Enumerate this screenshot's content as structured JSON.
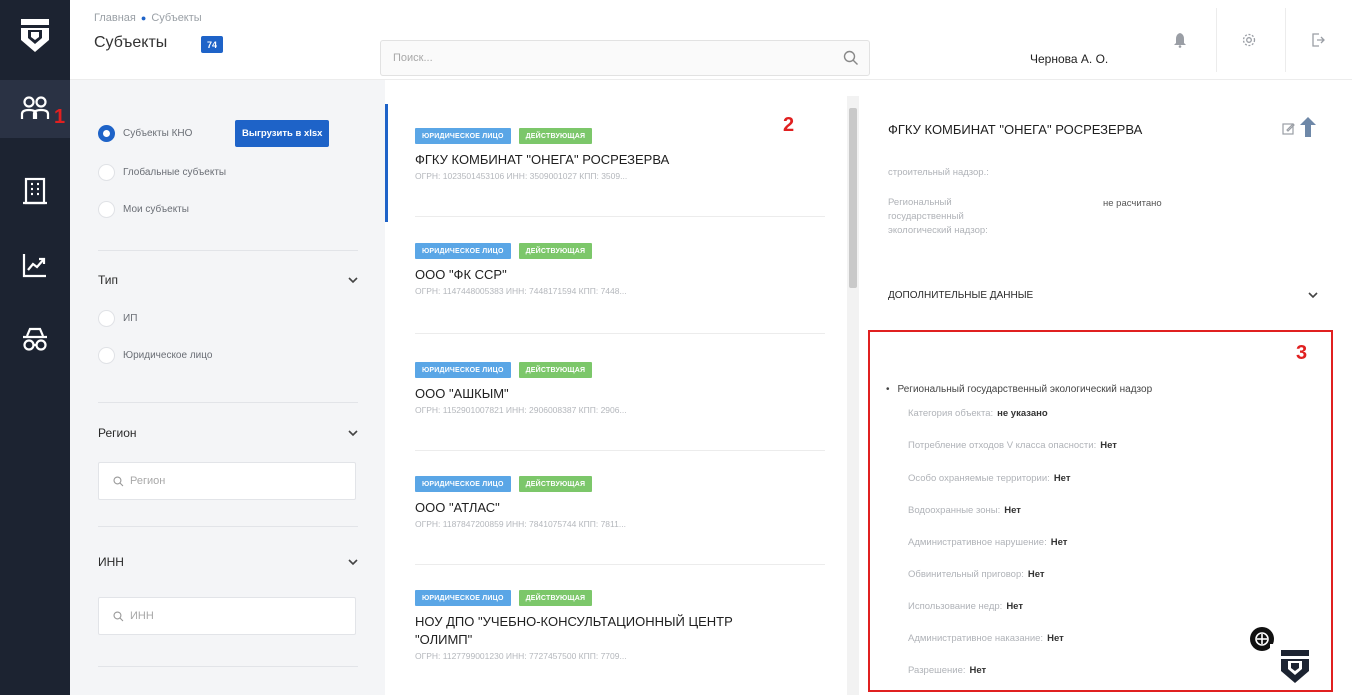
{
  "nav": {
    "items": [
      {
        "icon": "users-icon",
        "marker": "1"
      },
      {
        "icon": "building-icon"
      },
      {
        "icon": "chart-icon"
      },
      {
        "icon": "inspector-icon"
      }
    ]
  },
  "header": {
    "breadcrumbs": [
      "Главная",
      "Субъекты"
    ],
    "title": "Субъекты",
    "count": "74",
    "search_placeholder": "Поиск...",
    "user_name": "Чернова А. О."
  },
  "filters": {
    "scope_options": [
      {
        "label": "Субъекты КНО",
        "checked": true
      },
      {
        "label": "Глобальные субъекты",
        "checked": false
      },
      {
        "label": "Мои субъекты",
        "checked": false
      }
    ],
    "export_label": "Выгрузить в xlsx",
    "type": {
      "title": "Тип",
      "options": [
        "ИП",
        "Юридическое лицо"
      ]
    },
    "region": {
      "title": "Регион",
      "placeholder": "Регион"
    },
    "inn": {
      "title": "ИНН",
      "placeholder": "ИНН"
    }
  },
  "list": {
    "marker": "2",
    "items": [
      {
        "tag_type": "ЮРИДИЧЕСКОЕ ЛИЦО",
        "tag_status": "ДЕЙСТВУЮЩАЯ",
        "name": "ФГКУ КОМБИНАТ \"ОНЕГА\" РОСРЕЗЕРВА",
        "meta": "ОГРН: 1023501453106   ИНН: 3509001027   КПП: 3509..."
      },
      {
        "tag_type": "ЮРИДИЧЕСКОЕ ЛИЦО",
        "tag_status": "ДЕЙСТВУЮЩАЯ",
        "name": "ООО \"ФК ССР\"",
        "meta": "ОГРН: 1147448005383   ИНН: 7448171594   КПП: 7448..."
      },
      {
        "tag_type": "ЮРИДИЧЕСКОЕ ЛИЦО",
        "tag_status": "ДЕЙСТВУЮЩАЯ",
        "name": "ООО \"АШКЫМ\"",
        "meta": "ОГРН: 1152901007821   ИНН: 2906008387   КПП: 2906..."
      },
      {
        "tag_type": "ЮРИДИЧЕСКОЕ ЛИЦО",
        "tag_status": "ДЕЙСТВУЮЩАЯ",
        "name": "ООО \"АТЛАС\"",
        "meta": "ОГРН: 1187847200859   ИНН: 7841075744   КПП: 7811..."
      },
      {
        "tag_type": "ЮРИДИЧЕСКОЕ ЛИЦО",
        "tag_status": "ДЕЙСТВУЮЩАЯ",
        "name": "НОУ ДПО \"УЧЕБНО-КОНСУЛЬТАЦИОННЫЙ ЦЕНТР \"ОЛИМП\"",
        "meta": "ОГРН: 1127799001230   ИНН: 7727457500   КПП: 7709..."
      }
    ]
  },
  "detail": {
    "title": "ФГКУ КОМБИНАТ \"ОНЕГА\" РОСРЕЗЕРВА",
    "partial_label": "строительный надзор.:",
    "regional_label": "Региональный государственный экологический надзор:",
    "regional_value": "не расчитано",
    "section_title": "ДОПОЛНИТЕЛЬНЫЕ ДАННЫЕ",
    "marker": "3",
    "block_title": "Региональный государственный экологический надзор",
    "fields": [
      {
        "label": "Категория объекта:",
        "value": "не указано"
      },
      {
        "label": "Потребление отходов V класса опасности:",
        "value": "Нет"
      },
      {
        "label": "Особо охраняемые территории:",
        "value": "Нет"
      },
      {
        "label": "Водоохранные зоны:",
        "value": "Нет"
      },
      {
        "label": "Административное нарушение:",
        "value": "Нет"
      },
      {
        "label": "Обвинительный приговор:",
        "value": "Нет"
      },
      {
        "label": "Использование недр:",
        "value": "Нет"
      },
      {
        "label": "Административное наказание:",
        "value": "Нет"
      },
      {
        "label": "Разрешение:",
        "value": "Нет"
      }
    ]
  }
}
